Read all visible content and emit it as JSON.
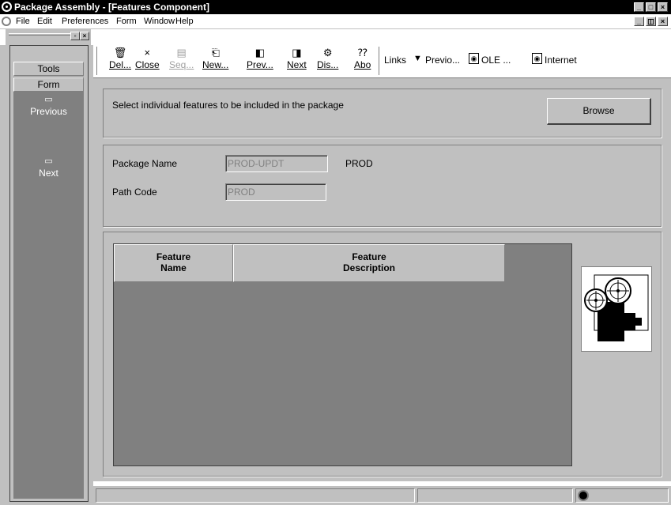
{
  "window": {
    "title": "Package Assembly - [Features Component]"
  },
  "menu": {
    "items": [
      "File",
      "Edit",
      "Preferences",
      "Form",
      "Window",
      "Help"
    ]
  },
  "sidebar": {
    "tools_label": "Tools",
    "form_label": "Form",
    "items": [
      {
        "label": "Previous"
      },
      {
        "label": "Next"
      }
    ]
  },
  "toolbar": {
    "buttons": [
      {
        "label": "Del...",
        "icon": "trash-icon",
        "glyph": "🗑"
      },
      {
        "label": "Close",
        "icon": "close-icon",
        "glyph": "×"
      },
      {
        "label": "Seq...",
        "icon": "sequence-icon",
        "glyph": "▤"
      },
      {
        "label": "New...",
        "icon": "new-icon",
        "glyph": "⎗"
      },
      {
        "label": "Prev...",
        "icon": "prev-icon",
        "glyph": "◧"
      },
      {
        "label": "Next",
        "icon": "next-icon",
        "glyph": "◨"
      },
      {
        "label": "Dis...",
        "icon": "display-icon",
        "glyph": "⚙"
      },
      {
        "label": "Abo",
        "icon": "about-icon",
        "glyph": "⁇"
      }
    ],
    "links_label": "Links",
    "previo_label": "Previo...",
    "ole_label": "OLE ...",
    "internet_label": "Internet"
  },
  "header_panel": {
    "instruction": "Select individual features to be included in the package",
    "browse_label": "Browse"
  },
  "form_panel": {
    "package_name_label": "Package Name",
    "package_name_value": "PROD-UPDT",
    "package_name_desc": "PROD",
    "path_code_label": "Path Code",
    "path_code_value": "PROD"
  },
  "grid": {
    "columns": [
      {
        "header": "Feature\nName"
      },
      {
        "header": "Feature\nDescription"
      }
    ],
    "rows": []
  },
  "colors": {
    "face": "#c0c0c0",
    "dark": "#808080",
    "titlebar": "#000000"
  }
}
